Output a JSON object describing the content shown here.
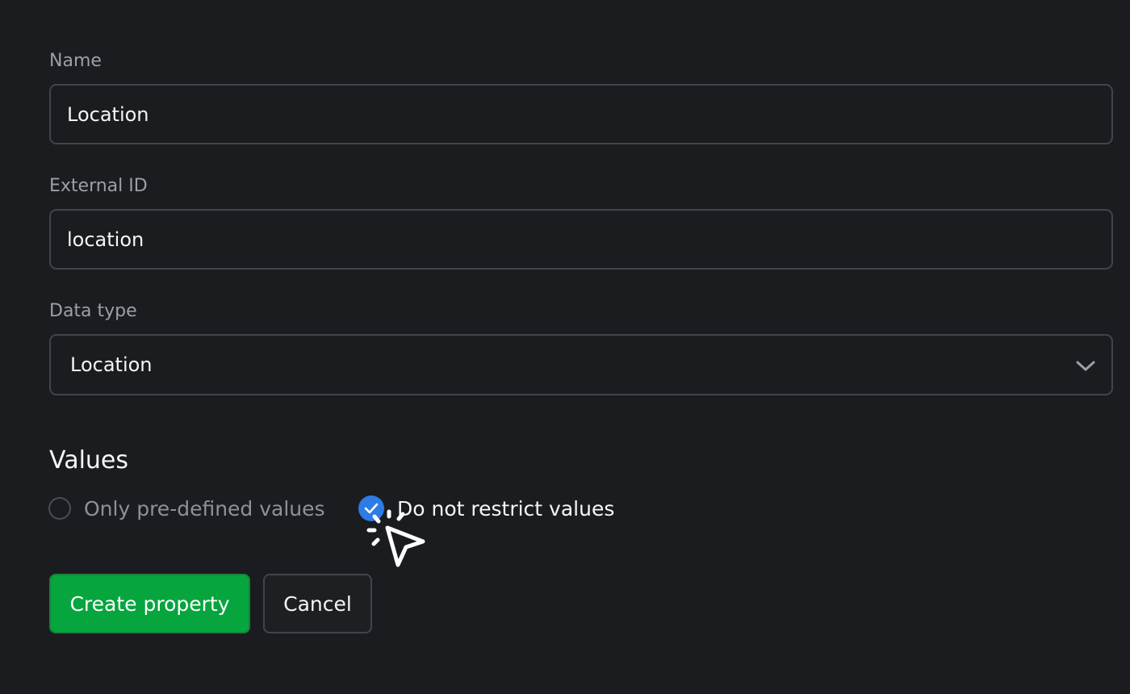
{
  "form": {
    "name": {
      "label": "Name",
      "value": "Location"
    },
    "external_id": {
      "label": "External ID",
      "value": "location"
    },
    "data_type": {
      "label": "Data type",
      "selected": "Location"
    }
  },
  "values_section": {
    "title": "Values",
    "options": [
      {
        "label": "Only pre-defined values",
        "checked": false
      },
      {
        "label": "Do not restrict values",
        "checked": true
      }
    ]
  },
  "actions": {
    "create_label": "Create property",
    "cancel_label": "Cancel"
  },
  "icons": {
    "chevron": "chevron-down-icon",
    "check": "check-icon",
    "cursor": "click-cursor-icon"
  },
  "colors": {
    "background": "#1b1c1f",
    "primary": "#06a53e",
    "accent": "#2d7be5",
    "border": "#41444b"
  }
}
